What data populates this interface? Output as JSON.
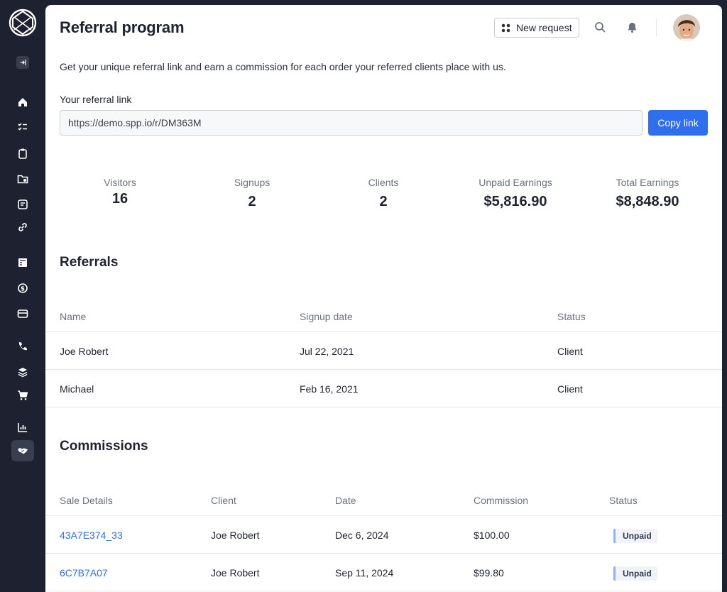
{
  "sidebar": {
    "items": [
      {
        "icon": "collapse-sidebar-icon"
      },
      {
        "icon": "home-icon"
      },
      {
        "icon": "checklist-icon"
      },
      {
        "icon": "clipboard-icon"
      },
      {
        "icon": "folder-icon"
      },
      {
        "icon": "message-icon"
      },
      {
        "icon": "link-icon"
      },
      {
        "icon": "store-icon"
      },
      {
        "icon": "money-icon"
      },
      {
        "icon": "credit-card-icon"
      },
      {
        "icon": "phone-icon"
      },
      {
        "icon": "layers-icon"
      },
      {
        "icon": "cart-icon"
      },
      {
        "icon": "bar-chart-icon"
      },
      {
        "icon": "handshake-icon"
      }
    ],
    "active": "handshake-icon"
  },
  "header": {
    "title": "Referral program",
    "new_request_label": "New request"
  },
  "intro": "Get your unique referral link and earn a commission for each order your referred clients place with us.",
  "referral_link": {
    "label": "Your referral link",
    "value": "https://demo.spp.io/r/DM363M",
    "copy_label": "Copy link"
  },
  "stats": [
    {
      "label": "Visitors",
      "value": "16"
    },
    {
      "label": "Signups",
      "value": "2"
    },
    {
      "label": "Clients",
      "value": "2"
    },
    {
      "label": "Unpaid Earnings",
      "value": "$5,816.90"
    },
    {
      "label": "Total Earnings",
      "value": "$8,848.90"
    }
  ],
  "referrals": {
    "title": "Referrals",
    "columns": [
      "Name",
      "Signup date",
      "Status"
    ],
    "rows": [
      {
        "name": "Joe Robert",
        "date": "Jul 22, 2021",
        "status": "Client"
      },
      {
        "name": "Michael",
        "date": "Feb 16, 2021",
        "status": "Client"
      }
    ]
  },
  "commissions": {
    "title": "Commissions",
    "columns": [
      "Sale Details",
      "Client",
      "Date",
      "Commission",
      "Status"
    ],
    "rows": [
      {
        "sale": "43A7E374_33",
        "client": "Joe Robert",
        "date": "Dec 6, 2024",
        "commission": "$100.00",
        "status": "Unpaid"
      },
      {
        "sale": "6C7B7A07",
        "client": "Joe Robert",
        "date": "Sep 11, 2024",
        "commission": "$99.80",
        "status": "Unpaid"
      }
    ]
  },
  "colors": {
    "sidebar_bg": "#1e2230",
    "accent": "#2f6fed",
    "badge_bar": "#8ab4f8"
  }
}
